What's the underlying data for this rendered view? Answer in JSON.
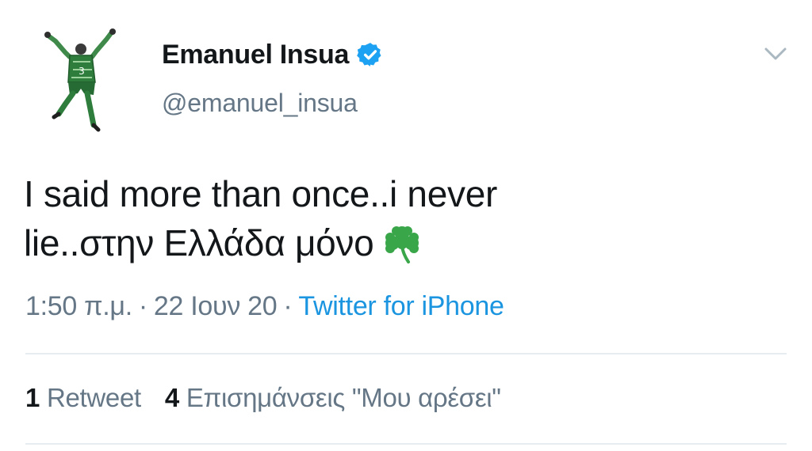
{
  "author": {
    "name": "Emanuel Insua",
    "handle": "@emanuel_insua",
    "verified": true
  },
  "tweet": {
    "line1": "I said more than once..i never",
    "line2": "lie..στην Ελλάδα μόνο",
    "emoji": "shamrock-icon"
  },
  "meta": {
    "time": "1:50 π.μ.",
    "separator": "·",
    "date": "22 Ιουν 20",
    "source": "Twitter for iPhone"
  },
  "stats": {
    "retweets_count": "1",
    "retweets_label": "Retweet",
    "likes_count": "4",
    "likes_label": "Επισημάνσεις \"Μου αρέσει\""
  },
  "colors": {
    "text": "#14171a",
    "secondary": "#657786",
    "link": "#1b95e0",
    "verified": "#1da1f2",
    "divider": "#e6ecf0",
    "shamrock": "#3aa64a"
  },
  "icons": {
    "avatar": "avatar",
    "verified": "verified-badge-icon",
    "menu": "chevron-down-icon",
    "emoji": "shamrock-icon"
  }
}
